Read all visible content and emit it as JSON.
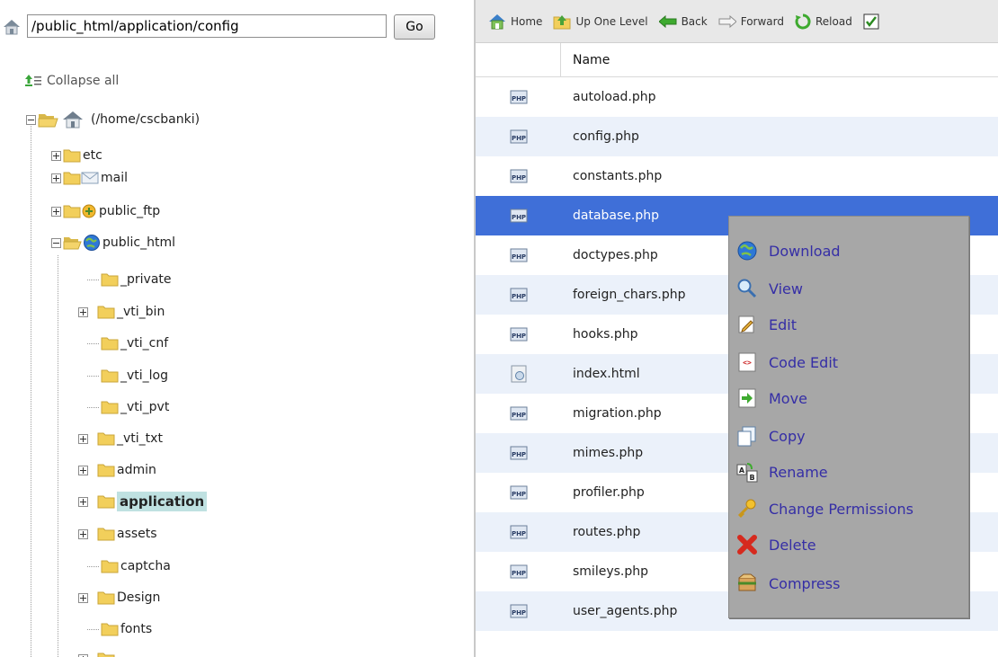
{
  "path_bar": {
    "value": "/public_html/application/config",
    "go_label": "Go"
  },
  "tree": {
    "collapse_all": "Collapse all",
    "root": "(/home/cscbanki)",
    "items": {
      "etc": "etc",
      "mail": "mail",
      "public_ftp": "public_ftp",
      "public_html": "public_html",
      "private": "_private",
      "vti_bin": "_vti_bin",
      "vti_cnf": "_vti_cnf",
      "vti_log": "_vti_log",
      "vti_pvt": "_vti_pvt",
      "vti_txt": "_vti_txt",
      "admin": "admin",
      "application": "application",
      "assets": "assets",
      "captcha": "captcha",
      "design": "Design",
      "fonts": "fonts"
    }
  },
  "toolbar": {
    "home": "Home",
    "up_one_level": "Up One Level",
    "back": "Back",
    "forward": "Forward",
    "reload": "Reload"
  },
  "file_table": {
    "header_name": "Name",
    "rows": [
      "autoload.php",
      "config.php",
      "constants.php",
      "database.php",
      "doctypes.php",
      "foreign_chars.php",
      "hooks.php",
      "index.html",
      "migration.php",
      "mimes.php",
      "profiler.php",
      "routes.php",
      "smileys.php",
      "user_agents.php"
    ]
  },
  "context_menu": {
    "download": "Download",
    "view": "View",
    "edit": "Edit",
    "code_edit": "Code Edit",
    "move": "Move",
    "copy": "Copy",
    "rename": "Rename",
    "change_permissions": "Change Permissions",
    "delete": "Delete",
    "compress": "Compress"
  },
  "colors": {
    "selected_row": "#3f6fd8",
    "alt_row": "#ebf1fa",
    "menu_bg": "#a7a7a7",
    "menu_text": "#352ea6",
    "tree_selected": "#bfe1e1"
  }
}
